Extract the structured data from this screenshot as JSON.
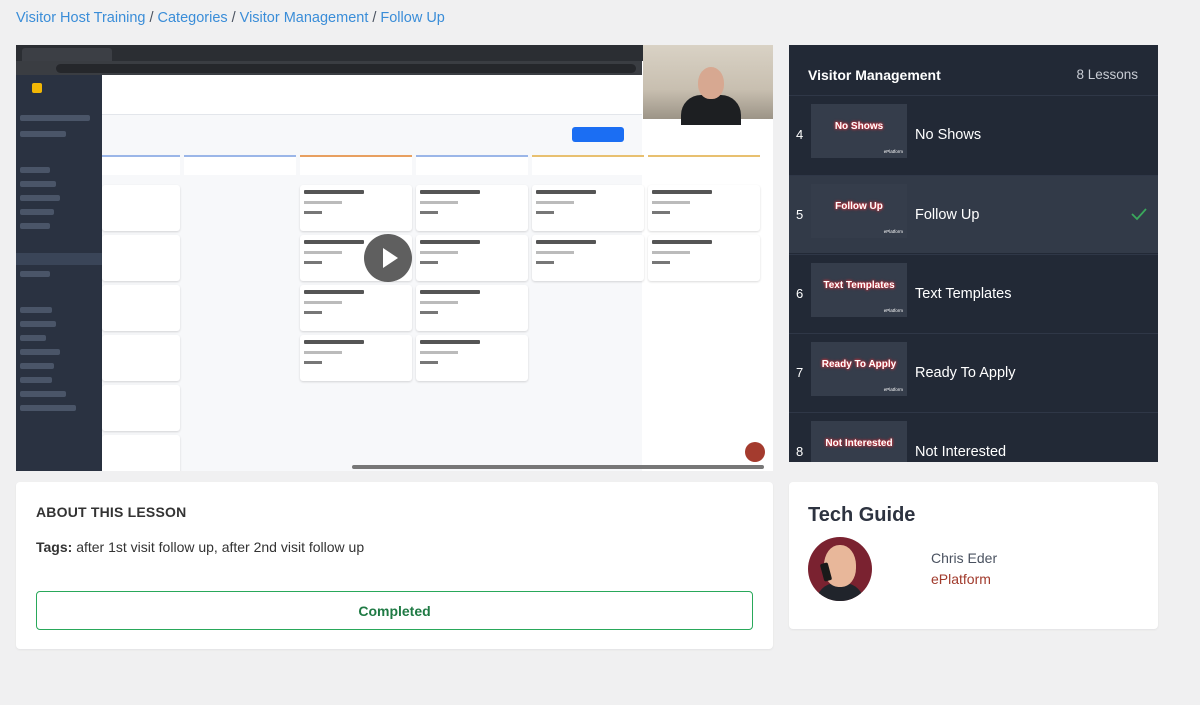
{
  "breadcrumb": {
    "items": [
      "Visitor Host Training",
      "Categories",
      "Visitor Management",
      "Follow Up"
    ],
    "separator": "/"
  },
  "video": {
    "state": "paused",
    "content": "screen recording of ePlatform opportunities board"
  },
  "lessons_panel": {
    "title": "Visitor Management",
    "count": "8 Lessons",
    "lessons": [
      {
        "number": "4",
        "title": "No Shows",
        "thumb_text": "No Shows",
        "completed": false,
        "active": false
      },
      {
        "number": "5",
        "title": "Follow Up",
        "thumb_text": "Follow Up",
        "completed": true,
        "active": true
      },
      {
        "number": "6",
        "title": "Text Templates",
        "thumb_text": "Text Templates",
        "completed": false,
        "active": false
      },
      {
        "number": "7",
        "title": "Ready To Apply",
        "thumb_text": "Ready To Apply",
        "completed": false,
        "active": false
      },
      {
        "number": "8",
        "title": "Not Interested",
        "thumb_text": "Not Interested",
        "completed": false,
        "active": false
      }
    ],
    "thumb_logo": "ePlatform"
  },
  "about": {
    "title": "ABOUT THIS LESSON",
    "tags_label": "Tags:",
    "tags_value": "after 1st visit follow up, after 2nd visit follow up",
    "completed_label": "Completed"
  },
  "guide": {
    "title": "Tech Guide",
    "name": "Chris Eder",
    "company": "ePlatform"
  },
  "colors": {
    "link": "#3a8dd8",
    "panel_bg": "#222936",
    "success": "#29a85a",
    "brand_red": "#a13a2c"
  }
}
